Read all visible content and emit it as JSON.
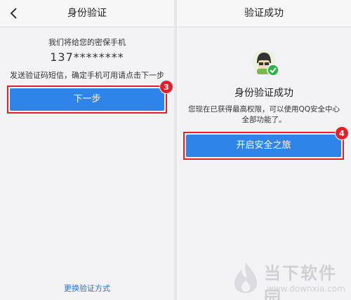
{
  "left": {
    "title": "身份验证",
    "line1": "我们将给您的密保手机",
    "phone": "137********",
    "line2": "发送验证码短信，确定手机可用请点击下一步",
    "next_button": "下一步",
    "step_badge": "3",
    "switch_link": "更换验证方式"
  },
  "right": {
    "title": "验证成功",
    "heading": "身份验证成功",
    "desc1": "您现在已获得最高权限，可以使用QQ安全中心",
    "desc2": "全部功能了。",
    "start_button": "开启安全之旅",
    "step_badge": "4"
  },
  "watermark": {
    "name": "当下软件园",
    "url": "www.downxia.com"
  },
  "colors": {
    "accent": "#2f84ea",
    "highlight": "#e2202a",
    "link": "#2f6ec9"
  }
}
